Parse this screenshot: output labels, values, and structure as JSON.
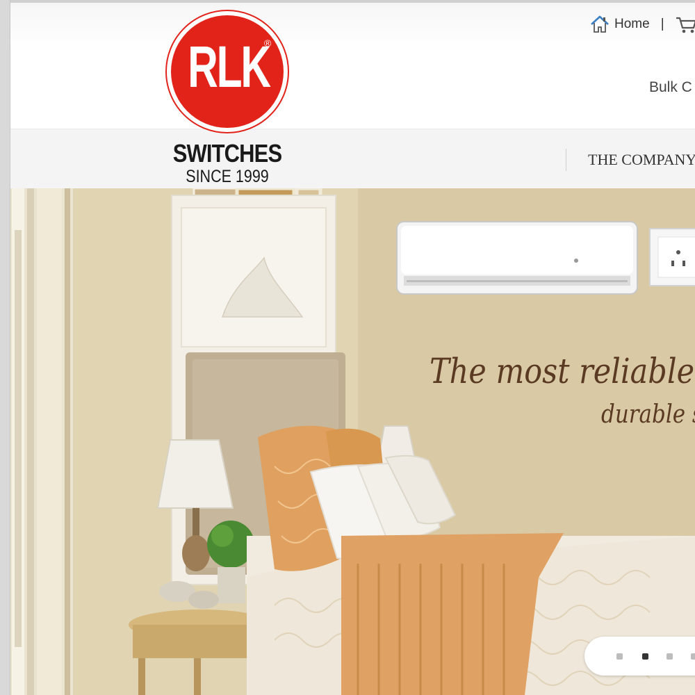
{
  "brand": {
    "logo_text": "RLK",
    "registered_mark": "®",
    "name": "SWITCHES",
    "since": "SINCE 1999",
    "brand_color": "#e2231a"
  },
  "top_links": {
    "home": "Home",
    "separator": "|",
    "home_icon": "home-icon",
    "cart_icon": "cart-icon"
  },
  "bulk_link": "Bulk C",
  "nav": {
    "company": "THE COMPANY"
  },
  "hero": {
    "tagline_line1": "The most reliable &",
    "tagline_line2": "durable s",
    "slider": {
      "slides": 4,
      "active_index": 1
    }
  }
}
